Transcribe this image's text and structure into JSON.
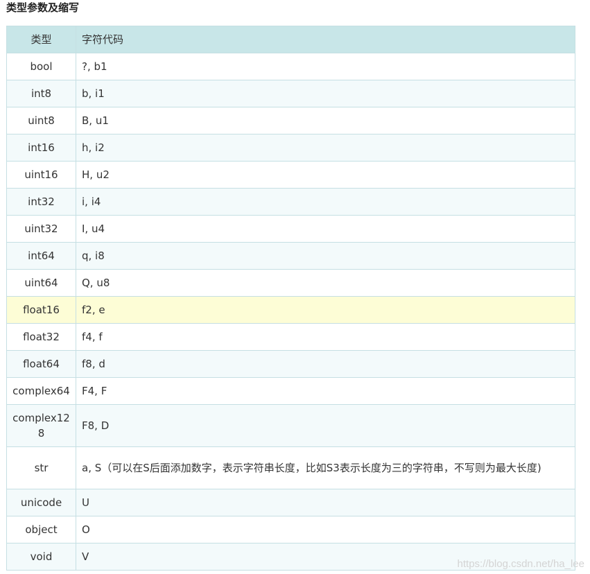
{
  "heading": "类型参数及缩写",
  "table": {
    "headers": [
      "类型",
      "字符代码"
    ],
    "rows": [
      {
        "type": "bool",
        "code": "?, b1"
      },
      {
        "type": "int8",
        "code": "b, i1"
      },
      {
        "type": "uint8",
        "code": "B, u1"
      },
      {
        "type": "int16",
        "code": "h, i2"
      },
      {
        "type": "uint16",
        "code": "H, u2"
      },
      {
        "type": "int32",
        "code": "i, i4"
      },
      {
        "type": "uint32",
        "code": "I, u4"
      },
      {
        "type": "int64",
        "code": "q, i8"
      },
      {
        "type": "uint64",
        "code": "Q, u8"
      },
      {
        "type": "float16",
        "code": "f2, e"
      },
      {
        "type": "float32",
        "code": "f4, f"
      },
      {
        "type": "float64",
        "code": "f8, d"
      },
      {
        "type": "complex64",
        "code": "F4, F"
      },
      {
        "type": "complex128",
        "code": "F8, D"
      },
      {
        "type": "str",
        "code": "a, S（可以在S后面添加数字，表示字符串长度，比如S3表示长度为三的字符串，不写则为最大长度)"
      },
      {
        "type": "unicode",
        "code": "U"
      },
      {
        "type": "object",
        "code": "O"
      },
      {
        "type": "void",
        "code": "V"
      }
    ]
  },
  "watermark": "https://blog.csdn.net/ha_lee",
  "colors": {
    "header_bg": "#c8e6e8",
    "highlight_row": "#fdfdd6",
    "border": "#c5dfe3"
  }
}
